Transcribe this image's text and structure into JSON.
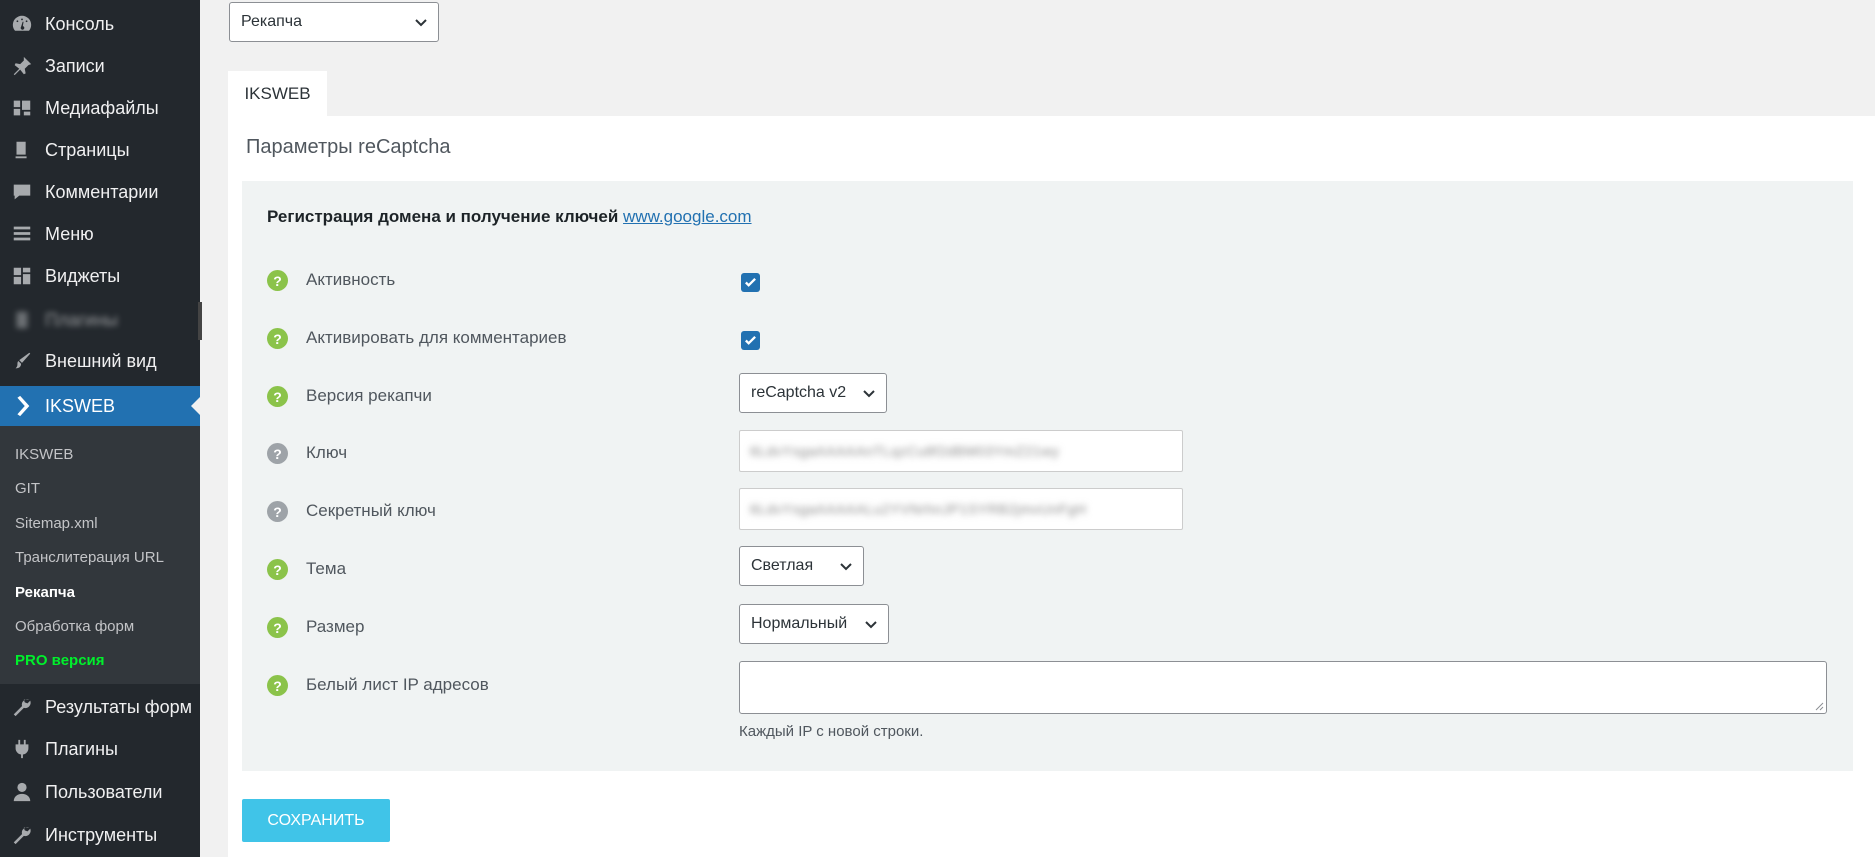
{
  "sidebar": {
    "menu": [
      {
        "label": "Консоль",
        "icon": "dashboard-icon"
      },
      {
        "label": "Записи",
        "icon": "pin-icon"
      },
      {
        "label": "Медиафайлы",
        "icon": "media-icon"
      },
      {
        "label": "Страницы",
        "icon": "pages-icon"
      },
      {
        "label": "Комментарии",
        "icon": "comment-icon"
      },
      {
        "label": "Меню",
        "icon": "menu-list-icon"
      },
      {
        "label": "Виджеты",
        "icon": "widgets-icon"
      },
      {
        "label": "Плагины",
        "icon": "plugin-icon"
      },
      {
        "label": "Внешний вид",
        "icon": "appearance-icon"
      },
      {
        "label": "IKSWEB",
        "icon": "chevron-right-icon"
      }
    ],
    "submenu": [
      {
        "label": "IKSWEB"
      },
      {
        "label": "GIT"
      },
      {
        "label": "Sitemap.xml"
      },
      {
        "label": "Транслитерация URL"
      },
      {
        "label": "Рекапча"
      },
      {
        "label": "Обработка форм"
      },
      {
        "label": "PRO версия"
      }
    ],
    "menu_bottom": [
      {
        "label": "Результаты форм",
        "icon": "wrench-icon"
      },
      {
        "label": "Плагины",
        "icon": "plugin-icon"
      },
      {
        "label": "Пользователи",
        "icon": "user-icon"
      },
      {
        "label": "Инструменты",
        "icon": "tools-icon"
      }
    ]
  },
  "top_select": {
    "value": "Рекапча"
  },
  "tab": {
    "label": "IKSWEB"
  },
  "section": {
    "title": "Параметры reCaptcha",
    "registration_text": "Регистрация домена и получение ключей ",
    "registration_link": "www.google.com"
  },
  "rows": [
    {
      "label": "Активность",
      "help": "green"
    },
    {
      "label": "Активировать для комментариев",
      "help": "green"
    },
    {
      "label": "Версия рекапчи",
      "help": "green"
    },
    {
      "label": "Ключ",
      "help": "grey"
    },
    {
      "label": "Секретный ключ",
      "help": "grey"
    },
    {
      "label": "Тема",
      "help": "green"
    },
    {
      "label": "Размер",
      "help": "green"
    },
    {
      "label": "Белый лист IP адресов",
      "help": "green"
    }
  ],
  "fields": {
    "active_checked": true,
    "comments_checked": true,
    "version": "reCaptcha v2",
    "key": "6LdvYsgaAAAAAnTLqzCu8f2dBM03YmZ21wy",
    "secret": "6LdvYsgaAAAAALu2YVNrhnJP1SYRB2jmvUnFgH",
    "theme": "Светлая",
    "size": "Нормальный",
    "whitelist_hint": "Каждый IP с новой строки."
  },
  "save_label": "СОХРАНИТЬ",
  "colors": {
    "sidebar": "#23282d",
    "active": "#2271b1",
    "save": "#40c4e8",
    "pro": "#00f02c",
    "help_green": "#8bc34a"
  }
}
